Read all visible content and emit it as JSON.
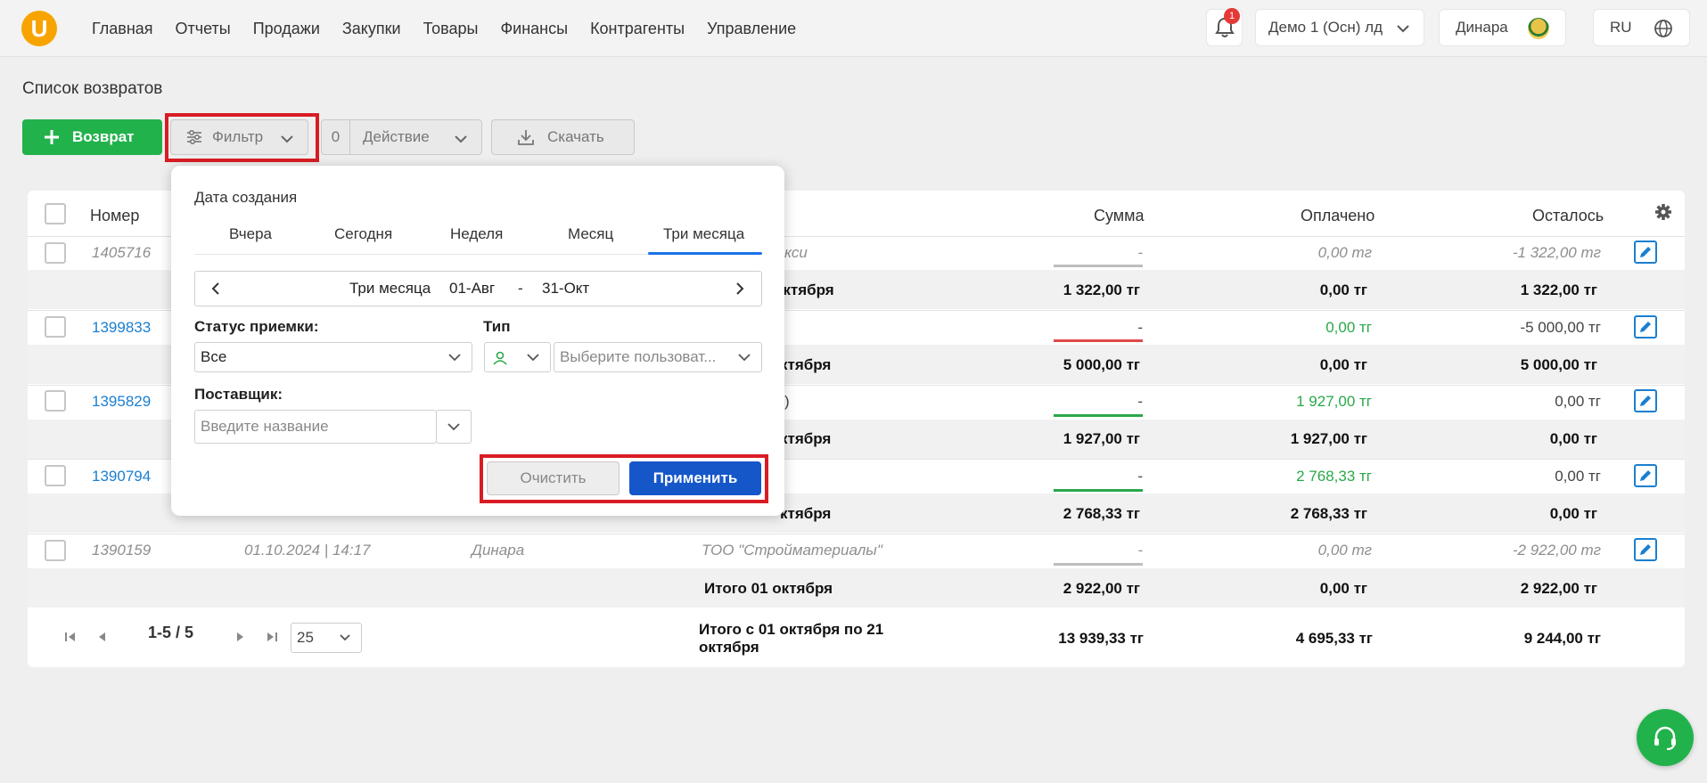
{
  "header": {
    "logo": "U",
    "nav": [
      "Главная",
      "Отчеты",
      "Продажи",
      "Закупки",
      "Товары",
      "Финансы",
      "Контрагенты",
      "Управление"
    ],
    "notifications_count": "1",
    "organization": "Демо 1 (Осн) лд",
    "user": "Динара",
    "language": "RU"
  },
  "page": {
    "title": "Список возвратов"
  },
  "toolbar": {
    "add_label": "Возврат",
    "filter_label": "Фильтр",
    "action_count": "0",
    "action_label": "Действие",
    "download_label": "Скачать"
  },
  "table": {
    "headers": {
      "number": "Номер",
      "sum": "Сумма",
      "paid": "Оплачено",
      "left": "Осталось"
    },
    "rows": [
      {
        "number": "1405716",
        "date": "",
        "user": "",
        "partner": "кси",
        "sum": "-",
        "paid": "0,00 тг",
        "left": "-1 322,00 тг",
        "subtotal_label": "октября",
        "subtotal_sum": "1 322,00 тг",
        "subtotal_paid": "0,00 тг",
        "subtotal_left": "1 322,00 тг"
      },
      {
        "number": "1399833",
        "date": "",
        "user": "",
        "partner": "",
        "sum": "-",
        "paid": "0,00 тг",
        "left": "-5 000,00 тг",
        "subtotal_label": "ктября",
        "subtotal_sum": "5 000,00 тг",
        "subtotal_paid": "0,00 тг",
        "subtotal_left": "5 000,00 тг"
      },
      {
        "number": "1395829",
        "date": "",
        "user": "",
        "partner": ")",
        "sum": "-",
        "paid": "1 927,00 тг",
        "left": "0,00 тг",
        "subtotal_label": "ктября",
        "subtotal_sum": "1 927,00 тг",
        "subtotal_paid": "1 927,00 тг",
        "subtotal_left": "0,00 тг"
      },
      {
        "number": "1390794",
        "date": "",
        "user": "",
        "partner": "",
        "sum": "-",
        "paid": "2 768,33 тг",
        "left": "0,00 тг",
        "subtotal_label": "ктября",
        "subtotal_sum": "2 768,33 тг",
        "subtotal_paid": "2 768,33 тг",
        "subtotal_left": "0,00 тг"
      },
      {
        "number": "1390159",
        "date": "01.10.2024 | 14:17",
        "user": "Динара",
        "partner": "ТОО \"Стройматериалы\"",
        "sum": "-",
        "paid": "0,00 тг",
        "left": "-2 922,00 тг",
        "subtotal_label": "Итого 01 октября",
        "subtotal_sum": "2 922,00 тг",
        "subtotal_paid": "0,00 тг",
        "subtotal_left": "2 922,00 тг"
      }
    ],
    "total": {
      "label_line1": "Итого с 01 октября по 21",
      "label_line2": "октября",
      "sum": "13 939,33 тг",
      "paid": "4 695,33 тг",
      "left": "9 244,00 тг"
    }
  },
  "pagination": {
    "range": "1-5 / 5",
    "per_page": "25"
  },
  "filter_popup": {
    "date_label": "Дата создания",
    "tabs": [
      "Вчера",
      "Сегодня",
      "Неделя",
      "Месяц",
      "Три месяца"
    ],
    "active_tab": "Три месяца",
    "range_label": "Три месяца",
    "range_from": "01-Авг",
    "range_sep": "-",
    "range_to": "31-Окт",
    "status_label": "Статус приемки:",
    "status_value": "Все",
    "type_label": "Тип",
    "user_placeholder": "Выберите пользоват...",
    "supplier_label": "Поставщик:",
    "supplier_placeholder": "Введите название",
    "clear_label": "Очистить",
    "apply_label": "Применить"
  },
  "colors": {
    "accent_green": "#22b24c",
    "primary_blue": "#1557c9",
    "highlight_red": "#d91c24",
    "link_blue": "#1a7fd0"
  }
}
